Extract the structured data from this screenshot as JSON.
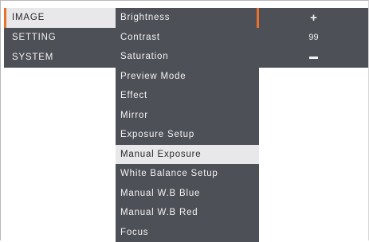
{
  "categories": [
    {
      "label": "IMAGE"
    },
    {
      "label": "SETTING"
    },
    {
      "label": "SYSTEM"
    }
  ],
  "submenu": [
    {
      "label": "Brightness"
    },
    {
      "label": "Contrast"
    },
    {
      "label": "Saturation"
    },
    {
      "label": "Preview Mode"
    },
    {
      "label": "Effect"
    },
    {
      "label": "Mirror"
    },
    {
      "label": "Exposure Setup"
    },
    {
      "label": "Manual Exposure"
    },
    {
      "label": "White Balance Setup"
    },
    {
      "label": "Manual W.B Blue"
    },
    {
      "label": "Manual W.B Red"
    },
    {
      "label": "Focus"
    }
  ],
  "value_panel": {
    "increase_symbol": "+",
    "value": "99",
    "decrease_icon": "minus-icon"
  },
  "colors": {
    "panel_bg": "#4e5058",
    "selected_bg": "#e8e8ea",
    "accent": "#e8712c",
    "text": "#f2f2f2"
  }
}
